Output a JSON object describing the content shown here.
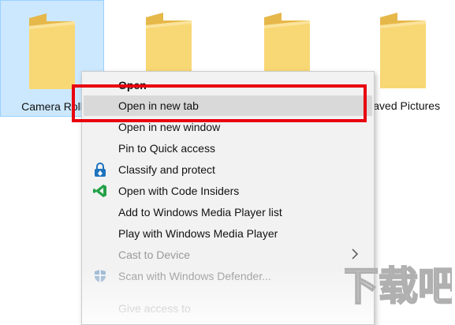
{
  "folders": [
    {
      "label": "Camera Roll",
      "selected": true
    },
    {
      "label": "",
      "selected": false
    },
    {
      "label": "",
      "selected": false
    },
    {
      "label": "Saved Pictures",
      "selected": false
    }
  ],
  "context_menu": {
    "items": [
      {
        "label": "Open",
        "bold": true
      },
      {
        "label": "Open in new tab",
        "hover": true
      },
      {
        "label": "Open in new window"
      },
      {
        "label": "Pin to Quick access"
      },
      {
        "label": "Classify and protect",
        "icon": "lock-shield-icon"
      },
      {
        "label": "Open with Code Insiders",
        "icon": "vscode-insiders-icon"
      },
      {
        "label": "Add to Windows Media Player list"
      },
      {
        "label": "Play with Windows Media Player"
      },
      {
        "label": "Cast to Device",
        "submenu": true,
        "disabled": true
      },
      {
        "label": "Scan with Windows Defender...",
        "icon": "defender-shield-icon",
        "disabled": true
      },
      {
        "label": "Give access to",
        "disabled": true
      }
    ]
  },
  "colors": {
    "selection": "#cce8ff",
    "menu_bg": "#f2f2f2",
    "hover": "#d9d9d9",
    "highlight_border": "#e8000f",
    "folder": "#f8d775"
  },
  "watermark": {
    "text": "下载吧"
  }
}
